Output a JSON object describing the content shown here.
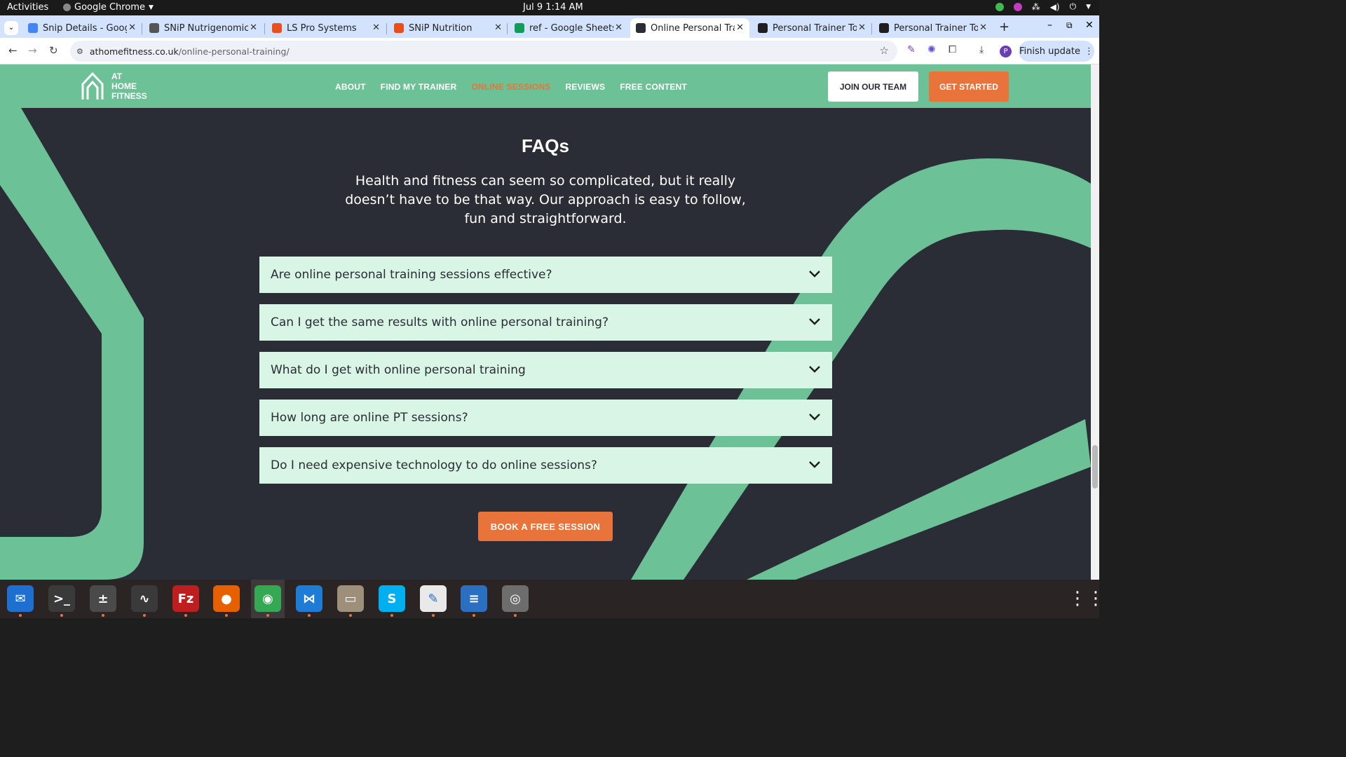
{
  "system": {
    "activities": "Activities",
    "app_name": "Google Chrome",
    "clock": "Jul 9  1:14 AM"
  },
  "tabs": [
    {
      "title": "Snip Details - Google",
      "color": "#4285f4"
    },
    {
      "title": "SNiP Nutrigenomics",
      "color": "#555555"
    },
    {
      "title": "LS Pro Systems",
      "color": "#e94e1b"
    },
    {
      "title": "SNiP Nutrition",
      "color": "#e94e1b"
    },
    {
      "title": "ref - Google Sheets",
      "color": "#0f9d58"
    },
    {
      "title": "Online Personal Trai",
      "color": "#2b2d36",
      "active": true
    },
    {
      "title": "Personal Trainer Tor",
      "color": "#1f1f1f"
    },
    {
      "title": "Personal Trainer Tor",
      "color": "#1f1f1f"
    }
  ],
  "browser": {
    "url_domain": "athomefitness.co.uk",
    "url_path": "/online-personal-training/",
    "finish_update": "Finish update",
    "profile_initial": "P"
  },
  "site": {
    "logo_lines": [
      "AT",
      "HOME",
      "FITNESS"
    ],
    "nav": [
      {
        "label": "ABOUT",
        "current": false
      },
      {
        "label": "FIND MY TRAINER",
        "current": false
      },
      {
        "label": "ONLINE SESSIONS",
        "current": true
      },
      {
        "label": "REVIEWS",
        "current": false
      },
      {
        "label": "FREE CONTENT",
        "current": false
      }
    ],
    "join_button": "JOIN OUR TEAM",
    "start_button": "GET STARTED"
  },
  "faq": {
    "title": "FAQs",
    "intro": "Health and fitness can seem so complicated, but it really doesn’t have to be that way. Our approach is easy to follow, fun and straightforward.",
    "items": [
      "Are online personal training sessions effective?",
      "Can I get the same results with online personal training?",
      "What do I get with online personal training",
      "How long are online PT sessions?",
      "Do I need expensive technology to do online sessions?"
    ],
    "cta": "BOOK A FREE SESSION"
  },
  "colors": {
    "brand_green": "#6cc196",
    "brand_orange": "#e8743b",
    "page_dark": "#2b2d36",
    "faq_bg": "#d8f5e5"
  },
  "dock": [
    {
      "name": "thunderbird",
      "color": "#1f6fd1",
      "glyph": "✉"
    },
    {
      "name": "terminal",
      "color": "#3a3a3a",
      "glyph": ">_"
    },
    {
      "name": "calculator",
      "color": "#4a4a4a",
      "glyph": "±"
    },
    {
      "name": "system-monitor",
      "color": "#3a3a3a",
      "glyph": "∿"
    },
    {
      "name": "filezilla",
      "color": "#bf1e1e",
      "glyph": "Fz"
    },
    {
      "name": "firefox",
      "color": "#e66000",
      "glyph": "●"
    },
    {
      "name": "chrome",
      "color": "#34a853",
      "glyph": "◉"
    },
    {
      "name": "vscode",
      "color": "#1e7bd6",
      "glyph": "⋈"
    },
    {
      "name": "files",
      "color": "#9d8f7a",
      "glyph": "▭"
    },
    {
      "name": "skype",
      "color": "#00aff0",
      "glyph": "S"
    },
    {
      "name": "text-editor",
      "color": "#e9e9e9",
      "glyph": "✎"
    },
    {
      "name": "libreoffice-writer",
      "color": "#2a6fc1",
      "glyph": "≡"
    },
    {
      "name": "disks",
      "color": "#6d6d6d",
      "glyph": "◎"
    }
  ]
}
